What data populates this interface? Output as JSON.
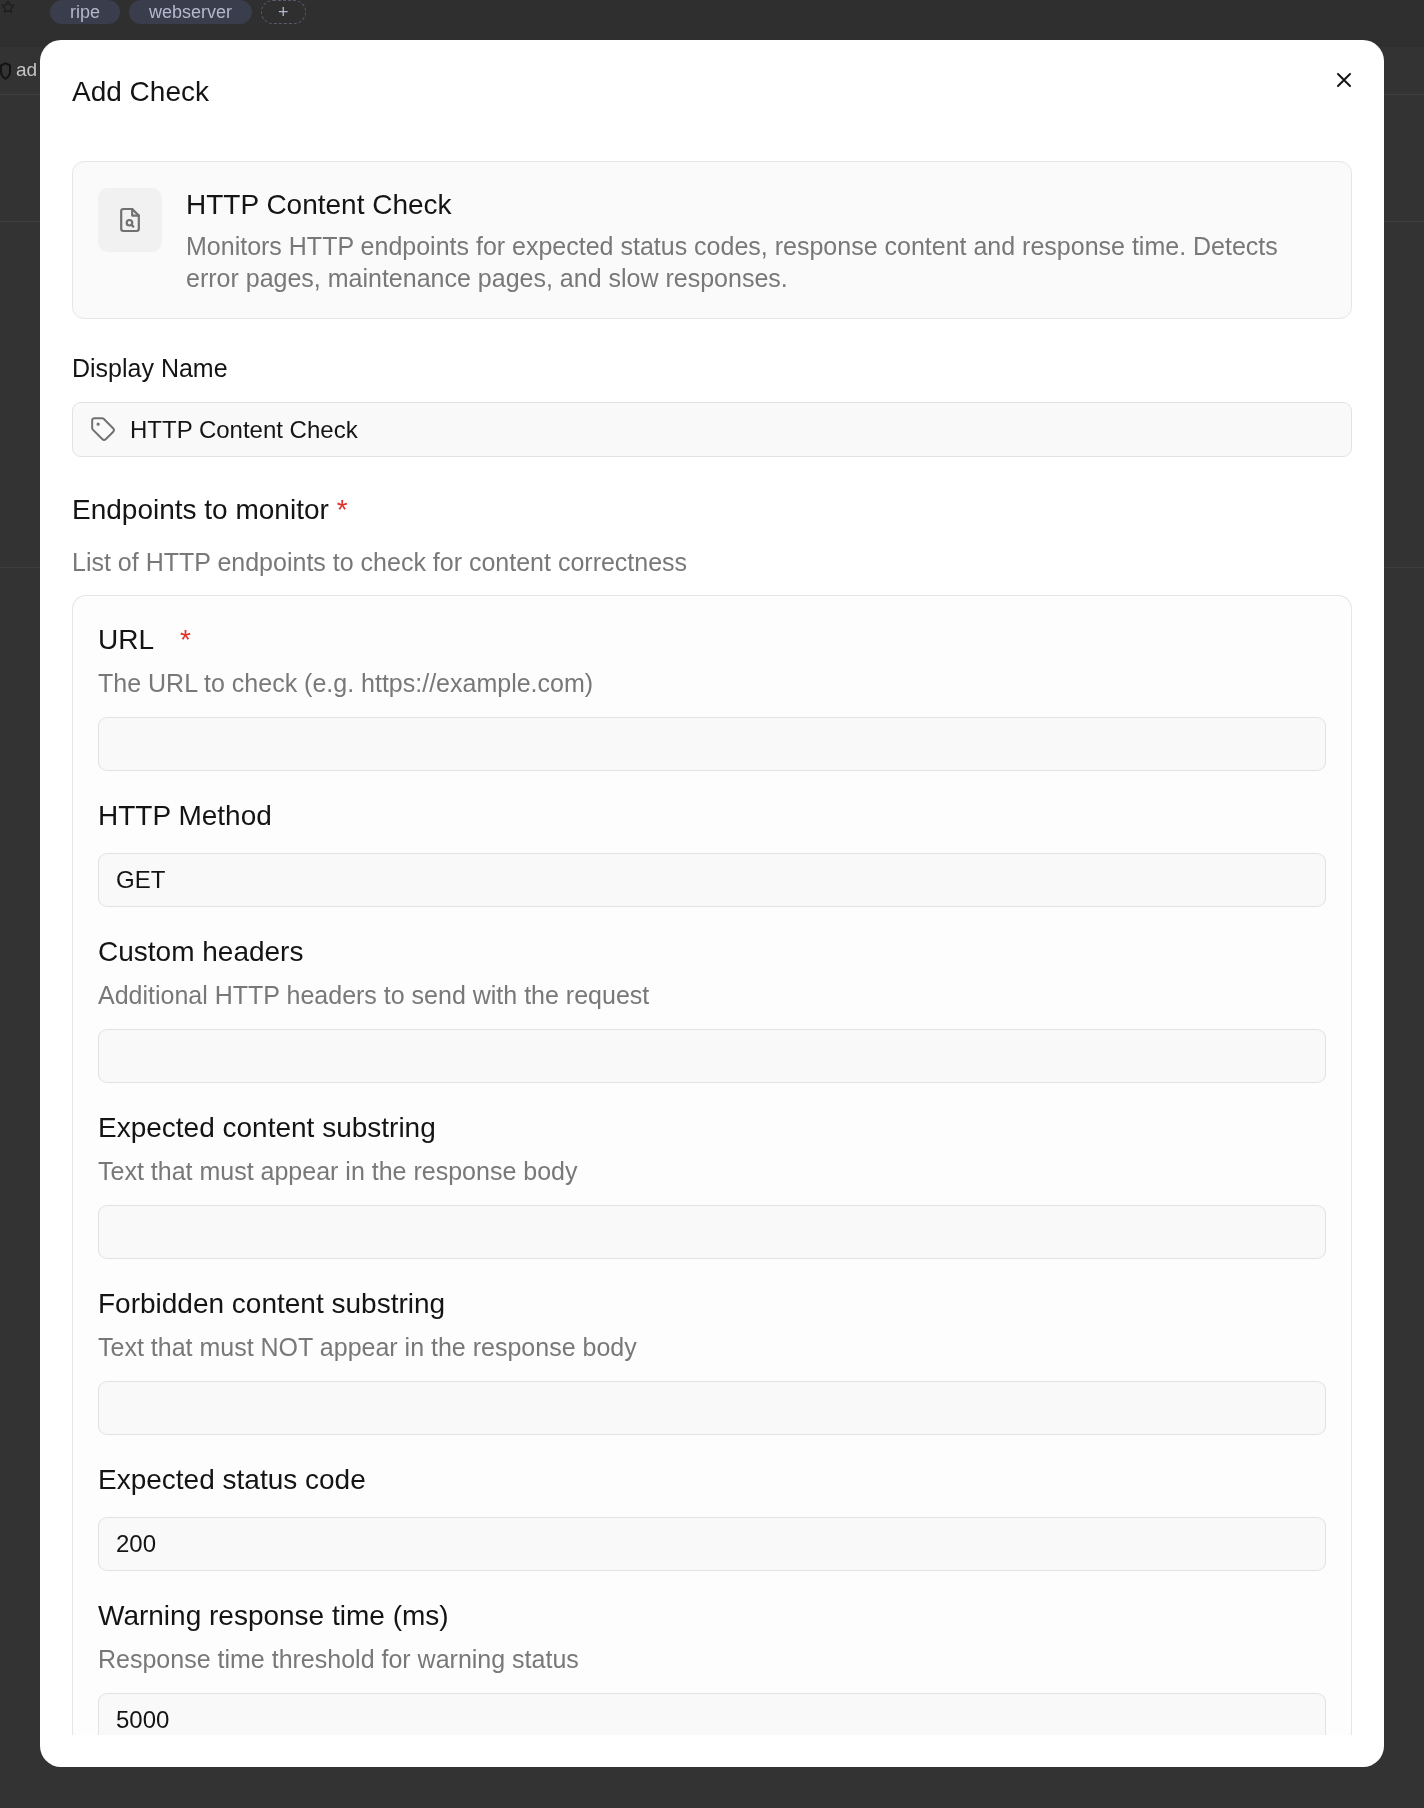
{
  "background": {
    "tags": [
      {
        "label": "ripe",
        "kind": "tag"
      },
      {
        "label": "webserver",
        "kind": "tag"
      },
      {
        "label": "+",
        "kind": "add"
      }
    ],
    "list_item": {
      "label": "ad"
    }
  },
  "dialog": {
    "title": "Add Check"
  },
  "check_type": {
    "title": "HTTP Content Check",
    "description": "Monitors HTTP endpoints for expected status codes, response content and response time. Detects error pages, maintenance pages, and slow responses."
  },
  "display_name": {
    "label": "Display Name",
    "value": "HTTP Content Check"
  },
  "endpoints": {
    "label": "Endpoints to monitor",
    "required_mark": "*",
    "description": "List of HTTP endpoints to check for content correctness",
    "fields": [
      {
        "label": "URL",
        "required_mark": "*",
        "description": "The URL to check (e.g. https://example.com)"
      },
      {
        "label": "HTTP Method",
        "value": "GET"
      },
      {
        "label": "Custom headers",
        "description": "Additional HTTP headers to send with the request"
      },
      {
        "label": "Expected content substring",
        "description": "Text that must appear in the response body"
      },
      {
        "label": "Forbidden content substring",
        "description": "Text that must NOT appear in the response body"
      },
      {
        "label": "Expected status code",
        "value": "200"
      },
      {
        "label": "Warning response time (ms)",
        "description": "Response time threshold for warning status",
        "value": "5000"
      }
    ]
  }
}
